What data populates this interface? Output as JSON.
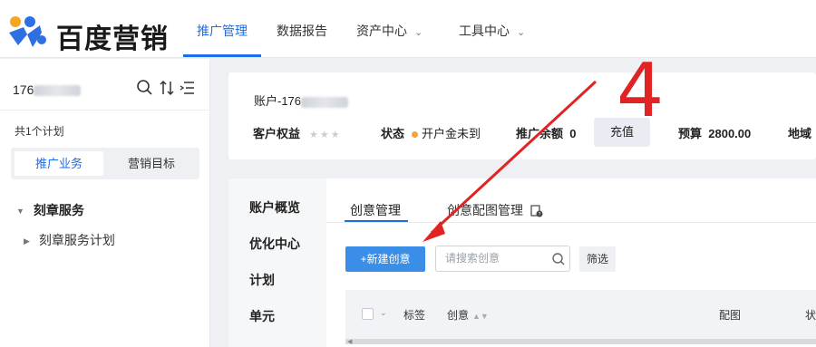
{
  "brand": {
    "name": "百度营销"
  },
  "nav": {
    "items": [
      {
        "label": "推广管理",
        "active": true
      },
      {
        "label": "数据报告"
      },
      {
        "label": "资产中心",
        "dropdown": true
      },
      {
        "label": "工具中心",
        "dropdown": true
      }
    ]
  },
  "sidebar": {
    "account_prefix": "176",
    "plan_count": "共1个计划",
    "tabs": [
      "推广业务",
      "营销目标"
    ],
    "tree": [
      {
        "label": "刻章服务",
        "expanded": true
      },
      {
        "label": "刻章服务计划"
      }
    ]
  },
  "account": {
    "title_prefix": "账户-176",
    "rights_label": "客户权益",
    "status_label": "状态",
    "status_value": "开户金未到",
    "balance_label": "推广余额",
    "balance_value": "0",
    "recharge": "充值",
    "budget_label": "预算",
    "budget_value": "2800.00",
    "region_label": "地域"
  },
  "left_menu": [
    "账户概览",
    "优化中心",
    "计划",
    "单元"
  ],
  "content_tabs": [
    {
      "label": "创意管理",
      "active": true
    },
    {
      "label": "创意配图管理"
    }
  ],
  "toolbar": {
    "new_button": "+新建创意",
    "search_placeholder": "请搜索创意",
    "filter": "筛选"
  },
  "table_headers": [
    "标签",
    "创意",
    "配图",
    "状"
  ],
  "annotation": {
    "number": "4"
  },
  "colors": {
    "accent": "#1a6ee8",
    "primary_button": "#3a8ee8",
    "annotation": "#e02424",
    "status_dot": "#f2a33a"
  }
}
